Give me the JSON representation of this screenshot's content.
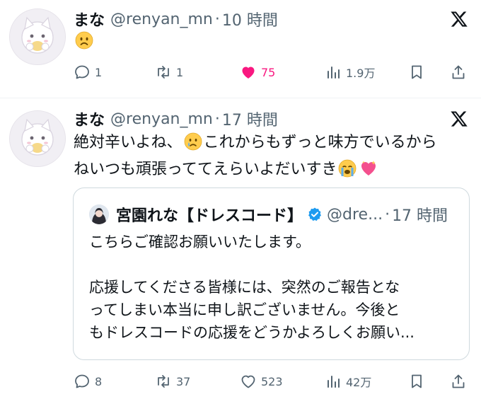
{
  "tweets": [
    {
      "author_name": "まな",
      "author_handle": "@renyan_mn",
      "separator": "·",
      "time": "10 時間",
      "text": "",
      "emoji": [
        "frowning-face-emoji"
      ],
      "actions": {
        "reply_count": "1",
        "retweet_count": "1",
        "like_count": "75",
        "view_count": "1.9万",
        "liked": true
      }
    },
    {
      "author_name": "まな",
      "author_handle": "@renyan_mn",
      "separator": "·",
      "time": "17 時間",
      "text_part1": "絶対辛いよね、",
      "text_part2": "これからもずっと味方でいるから",
      "text_part3": "ねいつも頑張っててえらいよだいすき",
      "emoji": [
        "sad-tear-emoji",
        "loudly-crying-emoji",
        "sparkling-heart-emoji"
      ],
      "quote": {
        "author_name": "宮園れな【ドレスコード】",
        "author_handle": "@dre...",
        "separator": "·",
        "time": "17 時間",
        "verified": true,
        "lines": [
          "こちらご確認お願いいたします。",
          "",
          "応援してくださる皆様には、突然のご報告とな",
          "ってしまい本当に申し訳ございません。今後と",
          "もドレスコードの応援をどうかよろしくお願い..."
        ]
      },
      "actions": {
        "reply_count": "8",
        "retweet_count": "37",
        "like_count": "523",
        "view_count": "42万",
        "liked": false
      }
    }
  ],
  "colors": {
    "text_primary": "#0f1419",
    "text_secondary": "#536471",
    "like_active": "#f91880",
    "verified_blue": "#1d9bf0",
    "divider": "#eff3f4",
    "quote_border": "#cfd9de"
  }
}
